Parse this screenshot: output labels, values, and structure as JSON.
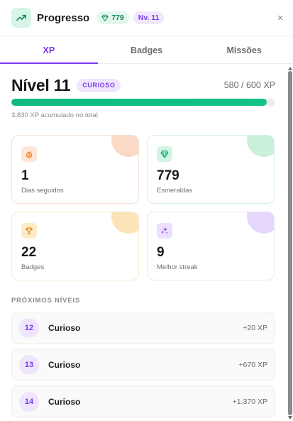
{
  "header": {
    "title": "Progresso",
    "gems": "779",
    "level_pill": "Nv. 11",
    "close_glyph": "×",
    "icon": "trending-up-icon",
    "accent": "#7c3aed",
    "green": "#10b981"
  },
  "tabs": [
    {
      "label": "XP",
      "active": true
    },
    {
      "label": "Badges",
      "active": false
    },
    {
      "label": "Missões",
      "active": false
    }
  ],
  "level": {
    "title": "Nível 11",
    "badge": "CURIOSO",
    "xp_text": "580 / 600 XP",
    "progress_fraction": 0.967,
    "total_text": "3.830 XP acumulado no total"
  },
  "stats": [
    {
      "value": "1",
      "label": "Dias seguidos",
      "icon": "flame-icon",
      "color": "#f97316"
    },
    {
      "value": "779",
      "label": "Esmeraldas",
      "icon": "gem-icon",
      "color": "#10b981"
    },
    {
      "value": "22",
      "label": "Badges",
      "icon": "trophy-icon",
      "color": "#d97706"
    },
    {
      "value": "9",
      "label": "Melhor streak",
      "icon": "sparkles-icon",
      "color": "#7c3aed"
    }
  ],
  "next_levels": {
    "title": "PRÓXIMOS NÍVEIS",
    "items": [
      {
        "level": "12",
        "name": "Curioso",
        "xp": "+20 XP"
      },
      {
        "level": "13",
        "name": "Curioso",
        "xp": "+670 XP"
      },
      {
        "level": "14",
        "name": "Curioso",
        "xp": "+1.370 XP"
      }
    ]
  }
}
